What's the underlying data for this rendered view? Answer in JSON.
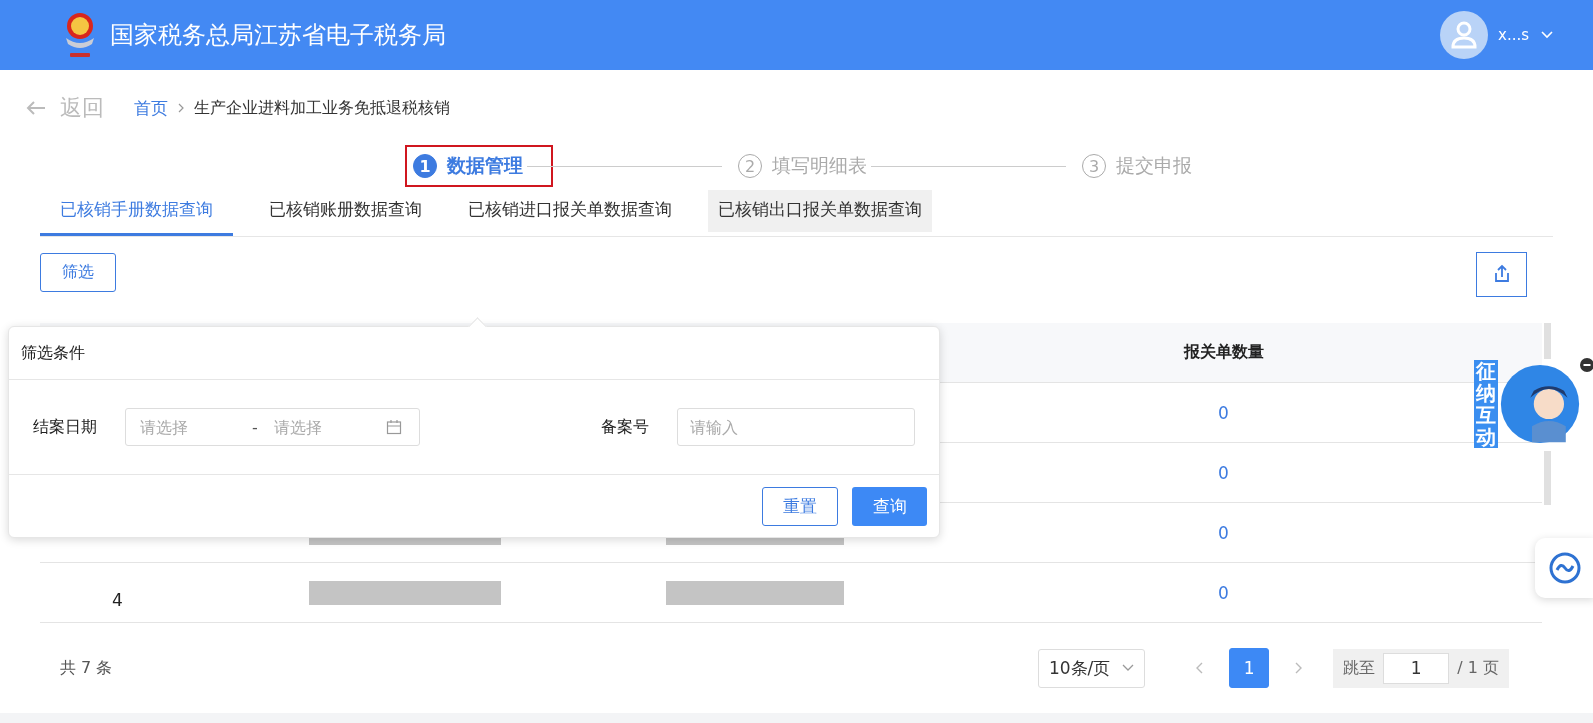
{
  "header": {
    "title": "国家税务总局江苏省电子税务局",
    "user": "x...s"
  },
  "breadcrumb": {
    "back": "返回",
    "home": "首页",
    "current": "生产企业进料加工业务免抵退税核销"
  },
  "steps": [
    {
      "number": "1",
      "label": "数据管理",
      "active": true,
      "highlighted": true
    },
    {
      "number": "2",
      "label": "填写明细表",
      "active": false,
      "highlighted": false
    },
    {
      "number": "3",
      "label": "提交申报",
      "active": false,
      "highlighted": false
    }
  ],
  "tabs": [
    {
      "label": "已核销手册数据查询",
      "selected": true,
      "hovered": false
    },
    {
      "label": "已核销账册数据查询",
      "selected": false,
      "hovered": false
    },
    {
      "label": "已核销进口报关单数据查询",
      "selected": false,
      "hovered": false
    },
    {
      "label": "已核销出口报关单数据查询",
      "selected": false,
      "hovered": true
    }
  ],
  "filter_button": "筛选",
  "filter_popup": {
    "title": "筛选条件",
    "date_label": "结案日期",
    "start_placeholder": "请选择",
    "separator": "-",
    "end_placeholder": "请选择",
    "record_label": "备案号",
    "record_placeholder": "请输入",
    "reset": "重置",
    "query": "查询"
  },
  "table": {
    "columns": [
      {
        "label": "报关单数量"
      }
    ],
    "rows": [
      {
        "count": "0"
      },
      {
        "count": "0"
      },
      {
        "count": "0",
        "redacted": true
      },
      {
        "index": "4",
        "count": "0",
        "redacted": true
      }
    ]
  },
  "assistant": {
    "label": "征纳互动"
  },
  "pagination": {
    "total": "共 7 条",
    "page_size": "10条/页",
    "pages": [
      {
        "label": "1",
        "selected": true
      }
    ],
    "jump_label": "跳至",
    "jump_value": "1",
    "page_count": "/ 1 页"
  }
}
